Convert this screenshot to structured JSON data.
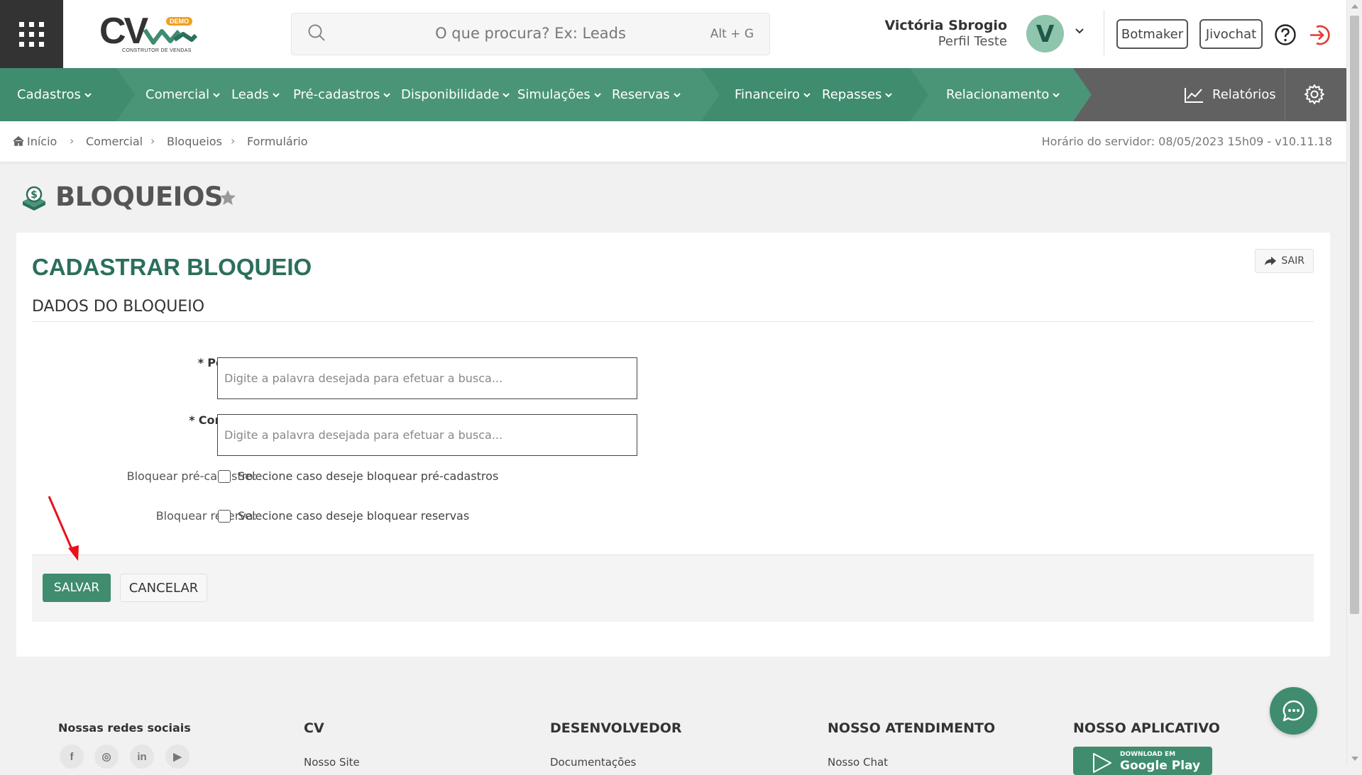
{
  "header": {
    "logo_text": "CV",
    "logo_badge": "DEMO",
    "logo_tagline": "CONSTRUTOR DE VENDAS",
    "search_placeholder": "O que procura? Ex: Leads",
    "search_shortcut": "Alt + G",
    "user_name": "Victória Sbrogio",
    "user_role": "Perfil Teste",
    "avatar_letter": "V",
    "botmaker_label": "Botmaker",
    "jivochat_label": "Jivochat",
    "colors": {
      "brand_green": "#3f8c6f",
      "exit_red": "#e53935"
    }
  },
  "nav": {
    "segments": [
      {
        "color": "#3f8c6f"
      },
      {
        "color": "#4a9577"
      },
      {
        "color": "#3f8c6f"
      },
      {
        "color": "#4a9577"
      }
    ],
    "items": [
      {
        "label": "Cadastros"
      },
      {
        "label": "Comercial"
      },
      {
        "label": "Leads"
      },
      {
        "label": "Pré-cadastros"
      },
      {
        "label": "Disponibilidade"
      },
      {
        "label": "Simulações"
      },
      {
        "label": "Reservas"
      },
      {
        "label": "Financeiro"
      },
      {
        "label": "Repasses"
      },
      {
        "label": "Relacionamento"
      }
    ],
    "reports_label": "Relatórios"
  },
  "breadcrumb": {
    "items": [
      "Início",
      "Comercial",
      "Bloqueios",
      "Formulário"
    ],
    "server_time": "Horário do servidor: 08/05/2023 15h09 - v10.11.18"
  },
  "page": {
    "title": "BLOQUEIOS"
  },
  "form": {
    "title": "CADASTRAR BLOQUEIO",
    "exit_label": "SAIR",
    "section_title": "DADOS DO BLOQUEIO",
    "required_mark": "*",
    "pessoa_label": "Pessoa:",
    "pessoa_placeholder": "Digite a palavra desejada para efetuar a busca...",
    "corretor_label": "Corretor:",
    "corretor_placeholder": "Digite a palavra desejada para efetuar a busca...",
    "block_precadastro_label": "Bloquear pré-cadastro:",
    "block_precadastro_text": "Selecione caso deseje bloquear pré-cadastros",
    "block_reserva_label": "Bloquear reserva:",
    "block_reserva_text": "Selecione caso deseje bloquear reservas",
    "save_label": "SALVAR",
    "cancel_label": "CANCELAR"
  },
  "footer": {
    "social_title": "Nossas redes sociais",
    "social_icons": [
      "f",
      "◎",
      "in",
      "▶"
    ],
    "columns": [
      {
        "title": "CV",
        "link": "Nosso Site"
      },
      {
        "title": "DESENVOLVEDOR",
        "link": "Documentações"
      },
      {
        "title": "NOSSO ATENDIMENTO",
        "link": "Nosso Chat"
      },
      {
        "title": "NOSSO APLICATIVO"
      }
    ],
    "app_badge_top": "DOWNLOAD EM",
    "app_badge_main": "Google Play"
  }
}
